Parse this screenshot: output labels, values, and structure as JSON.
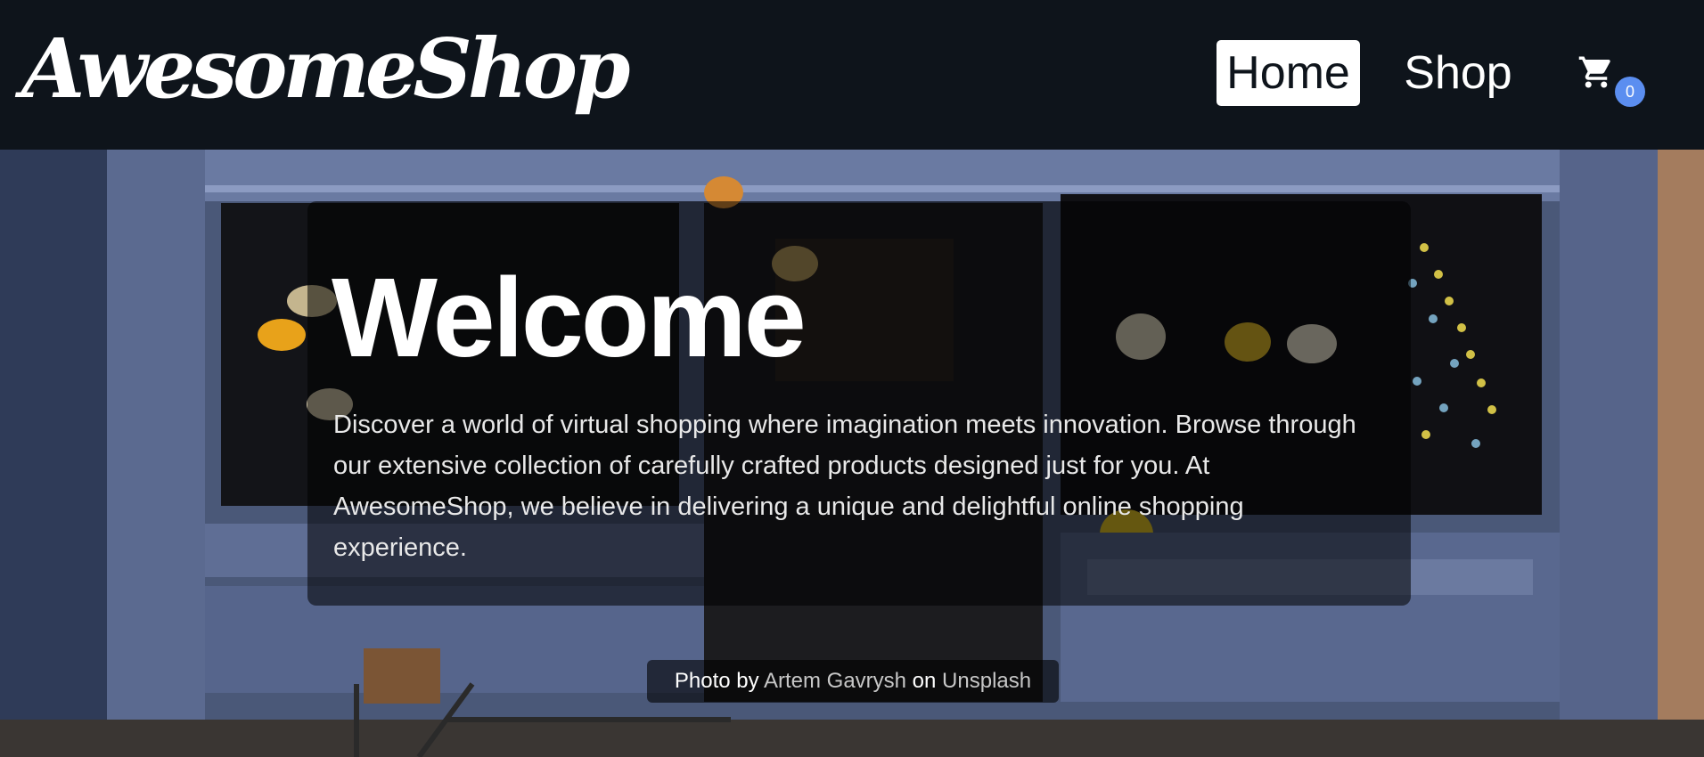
{
  "nav": {
    "brand": "AwesomeShop",
    "links": [
      {
        "label": "Home",
        "active": true
      },
      {
        "label": "Shop",
        "active": false
      }
    ],
    "cart": {
      "icon": "shopping-cart-icon",
      "count": "0",
      "badge_color": "#5b8ef0"
    }
  },
  "hero": {
    "title": "Welcome",
    "description": "Discover a world of virtual shopping where imagination meets innovation. Browse through our extensive collection of carefully crafted products designed just for you. At AwesomeShop, we believe in delivering a unique and delightful online shopping experience.",
    "credit": {
      "prefix": "Photo by",
      "author": "Artem Gavrysh",
      "middle": "on",
      "source": "Unsplash"
    }
  },
  "colors": {
    "navbar_background": "#0e141b",
    "text": "#ffffff",
    "storefront_blue": "#4f5e82"
  }
}
